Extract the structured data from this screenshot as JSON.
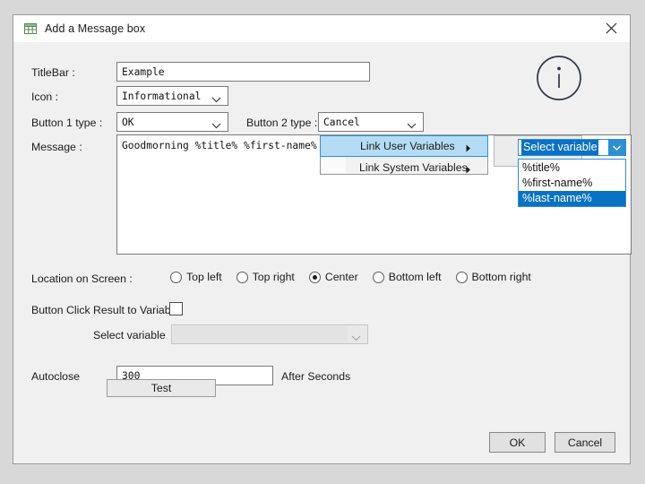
{
  "window": {
    "title": "Add a Message box",
    "title_icon": "grid-table-icon",
    "close_icon": "close-icon"
  },
  "fields": {
    "titlebar_label": "TitleBar :",
    "titlebar_value": "Example",
    "icon_label": "Icon :",
    "icon_value": "Informational",
    "button1_label": "Button 1 type :",
    "button1_value": "OK",
    "button2_label": "Button 2 type :",
    "button2_value": "Cancel",
    "message_label": "Message :",
    "message_value": "Goodmorning %title% %first-name%"
  },
  "preview_icon": "information-circle-icon",
  "context_menu": {
    "items": [
      {
        "label": "Link User Variables",
        "selected": true,
        "has_submenu": true
      },
      {
        "label": "Link System Variables",
        "selected": false,
        "has_submenu": true
      }
    ]
  },
  "variable_dropdown": {
    "selected_text": "Select variable",
    "options": [
      {
        "label": "%title%",
        "selected": false
      },
      {
        "label": "%first-name%",
        "selected": false
      },
      {
        "label": "%last-name%",
        "selected": true
      }
    ]
  },
  "location": {
    "label": "Location on Screen :",
    "options": [
      {
        "label": "Top left",
        "selected": false
      },
      {
        "label": "Top right",
        "selected": false
      },
      {
        "label": "Center",
        "selected": true
      },
      {
        "label": "Bottom left",
        "selected": false
      },
      {
        "label": "Bottom right",
        "selected": false
      }
    ]
  },
  "result_to_variable": {
    "label": "Button Click Result to Variable",
    "checked": false,
    "select_variable_label": "Select variable",
    "select_variable_value": ""
  },
  "autoclose": {
    "label": "Autoclose",
    "value": "300",
    "suffix_label": "After Seconds",
    "test_button": "Test"
  },
  "footer": {
    "ok": "OK",
    "cancel": "Cancel"
  },
  "colors": {
    "accent_blue": "#0a72c4",
    "menu_highlight": "#b5dcf5",
    "dialog_bg": "#f0f0f0",
    "desktop_bg": "#d8d8d8"
  }
}
